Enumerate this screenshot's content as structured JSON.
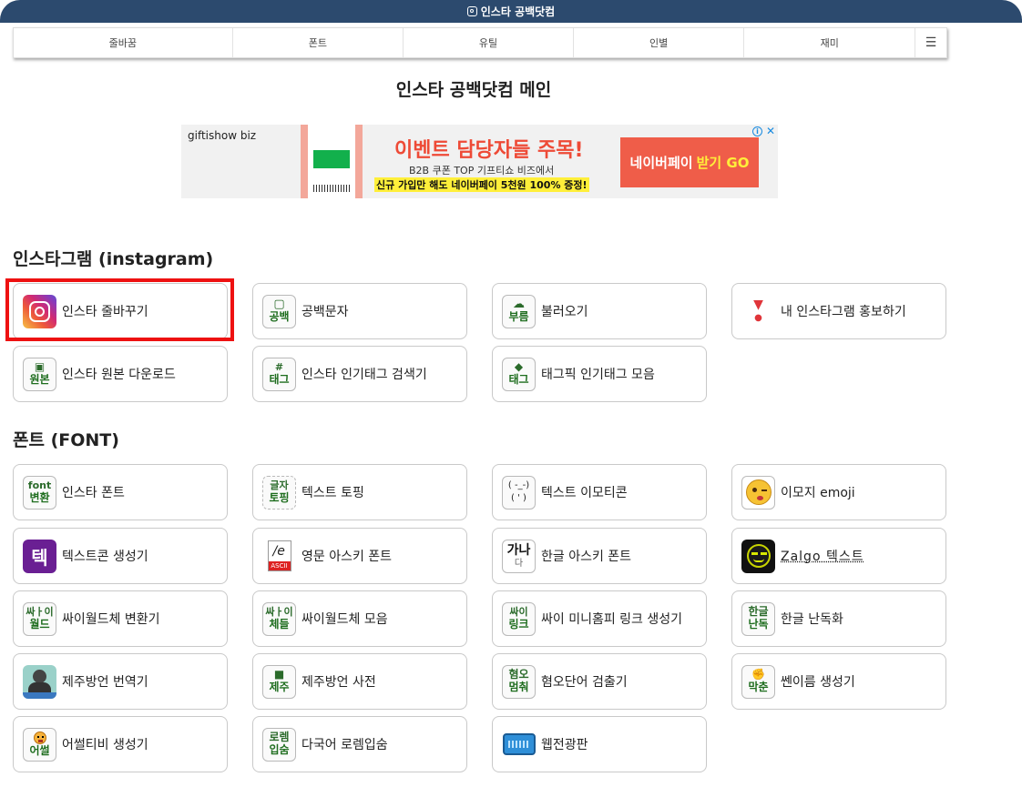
{
  "topbar": {
    "title": "인스타 공백닷컴"
  },
  "nav": {
    "items": [
      "줄바꿈",
      "폰트",
      "유틸",
      "인별",
      "재미"
    ],
    "menu_icon": "☰"
  },
  "page_title": "인스타 공백닷컴 메인",
  "ad": {
    "brand": "giftishow biz",
    "headline": "이벤트 담당자들 주목!",
    "sub1": "B2B 쿠폰 TOP 기프티쇼 비즈에서",
    "sub2": "신규 가입만 해도 네이버페이 5천원 100% 증정!",
    "cta_main": "네이버페이",
    "cta_highlight": "받기 GO",
    "info": "i",
    "close": "✕"
  },
  "sections": {
    "instagram": "인스타그램 (instagram)",
    "font": "폰트 (FONT)"
  },
  "instagram_cards": [
    {
      "label": "인스타 줄바꾸기",
      "icon": "instagram-icon"
    },
    {
      "label": "공백문자",
      "icon": "note-icon",
      "badge_bot": "공백"
    },
    {
      "label": "불러오기",
      "icon": "cloud-upload-icon",
      "badge_bot": "부름"
    },
    {
      "label": "내 인스타그램 홍보하기",
      "icon": "exclamation-icon"
    },
    {
      "label": "인스타 원본 다운로드",
      "icon": "image-icon",
      "badge_bot": "원본"
    },
    {
      "label": "인스타 인기태그 검색기",
      "icon": "hash-icon",
      "badge_top": "#",
      "badge_bot": "태그"
    },
    {
      "label": "태그픽 인기태그 모음",
      "icon": "tag-icon",
      "badge_bot": "태그"
    }
  ],
  "font_cards": [
    {
      "label": "인스타 폰트",
      "icon": "font-icon",
      "badge_top": "font",
      "badge_bot": "변환"
    },
    {
      "label": "텍스트 토핑",
      "icon": "text-topping-icon",
      "badge_top": "글자",
      "badge_bot": "토핑"
    },
    {
      "label": "텍스트 이모티콘",
      "icon": "emoticon-icon",
      "badge_top": "( -_-)",
      "badge_bot": "( ' )"
    },
    {
      "label": "이모지 emoji",
      "icon": "wink-emoji-icon"
    },
    {
      "label": "텍스트콘 생성기",
      "icon": "textcon-icon",
      "badge_top": "텍"
    },
    {
      "label": "영문 아스키 폰트",
      "icon": "ascii-file-icon",
      "badge_top": "/e",
      "badge_bot": "ASCII"
    },
    {
      "label": "한글 아스키 폰트",
      "icon": "hangul-ascii-icon",
      "badge_top": "가나",
      "badge_bot": "다"
    },
    {
      "label": "Zalgo 텍스트",
      "icon": "zalgo-face-icon"
    },
    {
      "label": "싸이월드체 변환기",
      "icon": "cyworld-icon",
      "badge_top": "싸ㅏ이",
      "badge_bot": "월드"
    },
    {
      "label": "싸이월드체 모음",
      "icon": "cyworld-icon",
      "badge_top": "싸ㅏ이",
      "badge_bot": "체들"
    },
    {
      "label": "싸이 미니홈피 링크 생성기",
      "icon": "link-icon",
      "badge_top": "싸이",
      "badge_bot": "링크"
    },
    {
      "label": "한글 난독화",
      "icon": "obfuscate-icon",
      "badge_top": "한글",
      "badge_bot": "난독"
    },
    {
      "label": "제주방언 번역기",
      "icon": "jeju-person-icon"
    },
    {
      "label": "제주방언 사전",
      "icon": "book-icon",
      "badge_bot": "제주"
    },
    {
      "label": "혐오단어 검출기",
      "icon": "filter-icon",
      "badge_top": "혐오",
      "badge_bot": "멈춰"
    },
    {
      "label": "쎈이름 생성기",
      "icon": "fist-icon",
      "badge_bot": "막춘"
    },
    {
      "label": "어썰티비 생성기",
      "icon": "angry-emoji-icon",
      "badge_bot": "어썰"
    },
    {
      "label": "다국어 로렘입숨",
      "icon": "lorem-icon",
      "badge_top": "로렘",
      "badge_bot": "입숨"
    },
    {
      "label": "웹전광판",
      "icon": "led-board-icon"
    }
  ],
  "colors": {
    "topbar": "#2c4a6e",
    "badge_text": "#1e6d1e",
    "highlight": "#ee1111",
    "ad_accent": "#ef5d49"
  }
}
